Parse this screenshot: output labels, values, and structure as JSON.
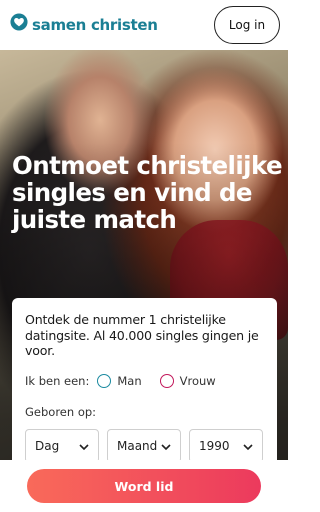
{
  "header": {
    "logo_text": "samen christen",
    "logo_icon": "heart-icon",
    "login_label": "Log in",
    "brand_color": "#1b7f94"
  },
  "hero": {
    "headline": "Ontmoet christelijke singles en vind de juiste match"
  },
  "form": {
    "intro": "Ontdek de nummer 1 christelijke datingsite. Al 40.000 singles gingen je voor.",
    "gender_label": "Ik ben een:",
    "gender_options": [
      {
        "label": "Man",
        "color": "#1b8aa0"
      },
      {
        "label": "Vrouw",
        "color": "#c2185b"
      }
    ],
    "born_label": "Geboren op:",
    "day_value": "Dag",
    "month_value": "Maand",
    "year_value": "1990"
  },
  "cta": {
    "label": "Word lid",
    "gradient_start": "#f96a5a",
    "gradient_end": "#ec3a5d"
  }
}
